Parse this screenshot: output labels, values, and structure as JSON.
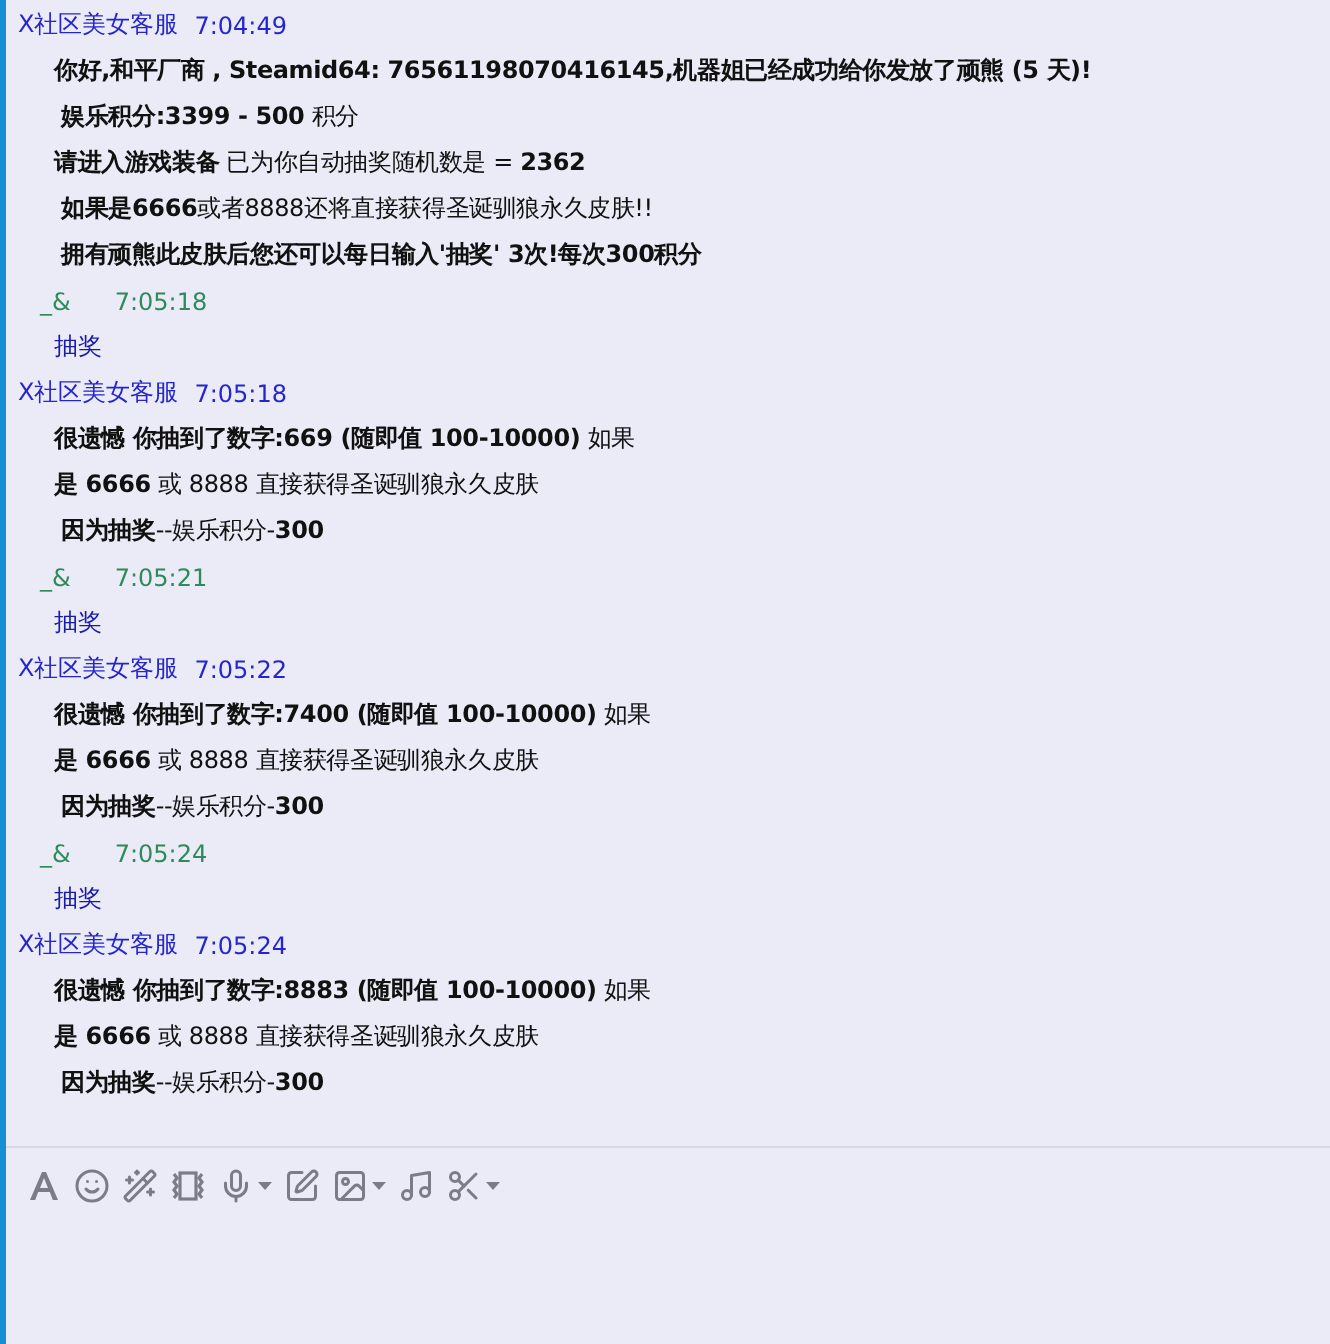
{
  "messages": [
    {
      "kind": "incoming",
      "sender": "X社区美女客服",
      "time": "7:04:49",
      "lines": [
        "**你好,和平厂商 , Steamid64: 76561198070416145,机器姐已经成功给你发放了顽熊 (5 天)!**",
        " **娱乐积分:3399 - 500** 积分",
        "**请进入游戏装备** 已为你自动抽奖随机数是 = **2362**",
        " **如果是6666**或者8888还将直接获得圣诞驯狼永久皮肤!!",
        " **拥有顽熊此皮肤后您还可以每日输入'抽奖' 3次!每次300积分**"
      ]
    },
    {
      "kind": "outgoing",
      "sender": "_&",
      "time": "7:05:18",
      "lines": [
        "抽奖"
      ]
    },
    {
      "kind": "incoming",
      "sender": "X社区美女客服",
      "time": "7:05:18",
      "lines": [
        "**很遗憾 你抽到了数字:669 (随即值 100-10000)** 如果",
        "**是 6666** 或 8888 直接获得圣诞驯狼永久皮肤",
        " **因为抽奖**--娱乐积分-**300**"
      ]
    },
    {
      "kind": "outgoing",
      "sender": "_&",
      "time": "7:05:21",
      "lines": [
        "抽奖"
      ]
    },
    {
      "kind": "incoming",
      "sender": "X社区美女客服",
      "time": "7:05:22",
      "lines": [
        "**很遗憾 你抽到了数字:7400 (随即值 100-10000)** 如果",
        "**是 6666** 或 8888 直接获得圣诞驯狼永久皮肤",
        " **因为抽奖**--娱乐积分-**300**"
      ]
    },
    {
      "kind": "outgoing",
      "sender": "_&",
      "time": "7:05:24",
      "lines": [
        "抽奖"
      ]
    },
    {
      "kind": "incoming",
      "sender": "X社区美女客服",
      "time": "7:05:24",
      "lines": [
        "**很遗憾 你抽到了数字:8883 (随即值 100-10000)** 如果",
        "**是 6666** 或 8888 直接获得圣诞驯狼永久皮肤",
        " **因为抽奖**--娱乐积分-**300**"
      ]
    }
  ],
  "toolbar": [
    {
      "kind": "font",
      "has_menu": false
    },
    {
      "kind": "emoji",
      "has_menu": false
    },
    {
      "kind": "magic",
      "has_menu": false
    },
    {
      "kind": "shake",
      "has_menu": false
    },
    {
      "kind": "voice",
      "has_menu": true
    },
    {
      "kind": "edit",
      "has_menu": false
    },
    {
      "kind": "image",
      "has_menu": true
    },
    {
      "kind": "music",
      "has_menu": false
    },
    {
      "kind": "screenshot",
      "has_menu": true
    }
  ]
}
